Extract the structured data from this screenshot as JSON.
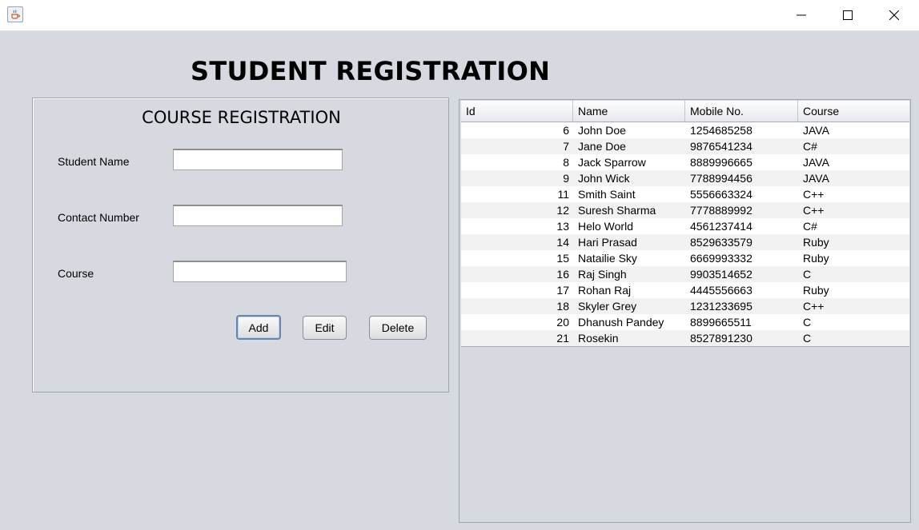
{
  "window": {
    "title": "",
    "icon": "java-cup-icon",
    "controls": [
      "minimize-icon",
      "maximize-icon",
      "close-icon"
    ]
  },
  "app_title": "STUDENT REGISTRATION",
  "form": {
    "title": "COURSE REGISTRATION",
    "fields": {
      "student_name": {
        "label": "Student Name",
        "value": ""
      },
      "contact_number": {
        "label": "Contact Number",
        "value": ""
      },
      "course": {
        "label": "Course",
        "value": ""
      }
    },
    "buttons": {
      "add": "Add",
      "edit": "Edit",
      "delete": "Delete"
    }
  },
  "table": {
    "columns": [
      "Id",
      "Name",
      "Mobile No.",
      "Course"
    ],
    "rows": [
      [
        "6",
        "John Doe",
        "1254685258",
        "JAVA"
      ],
      [
        "7",
        "Jane Doe",
        "9876541234",
        "C#"
      ],
      [
        "8",
        "Jack Sparrow",
        "8889996665",
        "JAVA"
      ],
      [
        "9",
        "John Wick",
        "7788994456",
        "JAVA"
      ],
      [
        "11",
        "Smith Saint",
        "5556663324",
        "C++"
      ],
      [
        "12",
        "Suresh Sharma",
        "7778889992",
        "C++"
      ],
      [
        "13",
        "Helo World",
        "4561237414",
        "C#"
      ],
      [
        "14",
        "Hari Prasad",
        "8529633579",
        "Ruby"
      ],
      [
        "15",
        "Natailie Sky",
        "6669993332",
        "Ruby"
      ],
      [
        "16",
        "Raj Singh",
        "9903514652",
        "C"
      ],
      [
        "17",
        "Rohan Raj",
        "4445556663",
        "Ruby"
      ],
      [
        "18",
        "Skyler Grey",
        "1231233695",
        "C++"
      ],
      [
        "20",
        "Dhanush Pandey",
        "8899665511",
        "C"
      ],
      [
        "21",
        "Rosekin",
        "8527891230",
        "C"
      ]
    ]
  }
}
